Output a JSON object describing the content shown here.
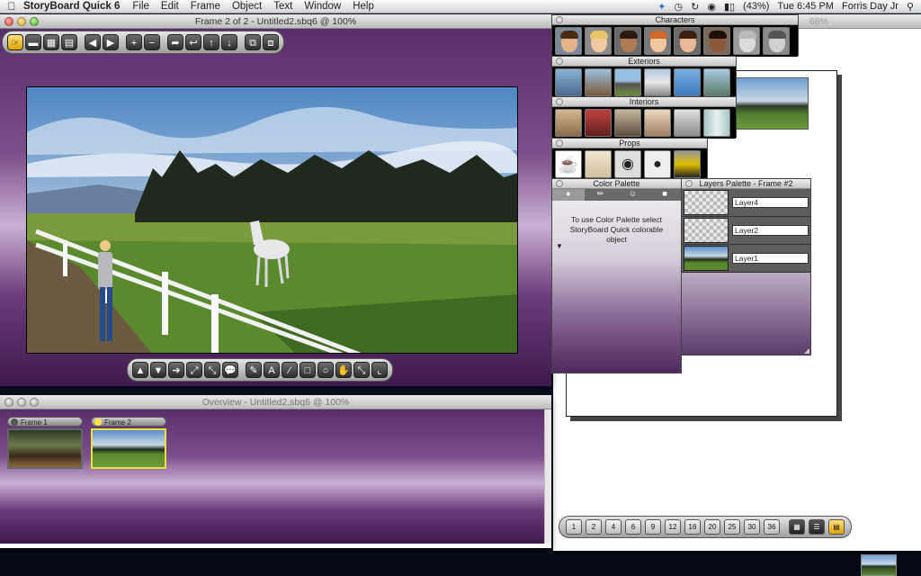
{
  "menubar": {
    "app_name": "StoryBoard Quick 6",
    "menus": [
      "File",
      "Edit",
      "Frame",
      "Object",
      "Text",
      "Window",
      "Help"
    ],
    "battery": "(43%)",
    "clock": "Tue 6:45 PM",
    "user": "Forris Day Jr"
  },
  "frame_window": {
    "title": "Frame 2 of 2 - Untitled2.sbq6 @ 100%"
  },
  "overview_window": {
    "title": "Overview - Untitled2.sbq6 @ 100%",
    "frames": [
      {
        "label": "Frame 1"
      },
      {
        "label": "Frame 2"
      }
    ]
  },
  "right_window": {
    "zoom": "68%"
  },
  "palettes": {
    "characters": {
      "title": "Characters"
    },
    "exteriors": {
      "title": "Exteriors"
    },
    "interiors": {
      "title": "Interiors"
    },
    "props": {
      "title": "Props"
    },
    "color": {
      "title": "Color Palette",
      "message": "To use Color Palette select StoryBoard Quick colorable object"
    },
    "layers": {
      "title": "Layers Palette - Frame #2",
      "items": [
        {
          "name": "Layer4"
        },
        {
          "name": "Layer2"
        },
        {
          "name": "Layer1"
        }
      ]
    }
  },
  "grid_buttons": [
    "1",
    "2",
    "4",
    "6",
    "9",
    "12",
    "16",
    "20",
    "25",
    "30",
    "36"
  ]
}
